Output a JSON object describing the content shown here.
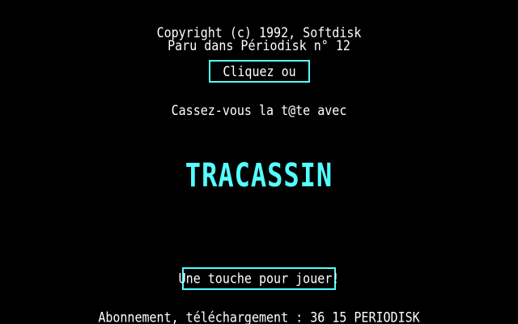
{
  "header": {
    "copyright": "Copyright (c) 1992, Softdisk",
    "published": "Paru dans Périodisk n° 12"
  },
  "click_button": {
    "label": "Cliquez ou"
  },
  "intro": {
    "text": "Cassez-vous la t@te avec"
  },
  "logo": {
    "text": "TRACASSIN"
  },
  "play_button": {
    "label": "Une touche pour jouer!"
  },
  "footer": {
    "text": "Abonnement, téléchargement : 36 15 PERIODISK"
  },
  "colors": {
    "background": "#000000",
    "text": "#ffffff",
    "accent": "#55ffff"
  }
}
